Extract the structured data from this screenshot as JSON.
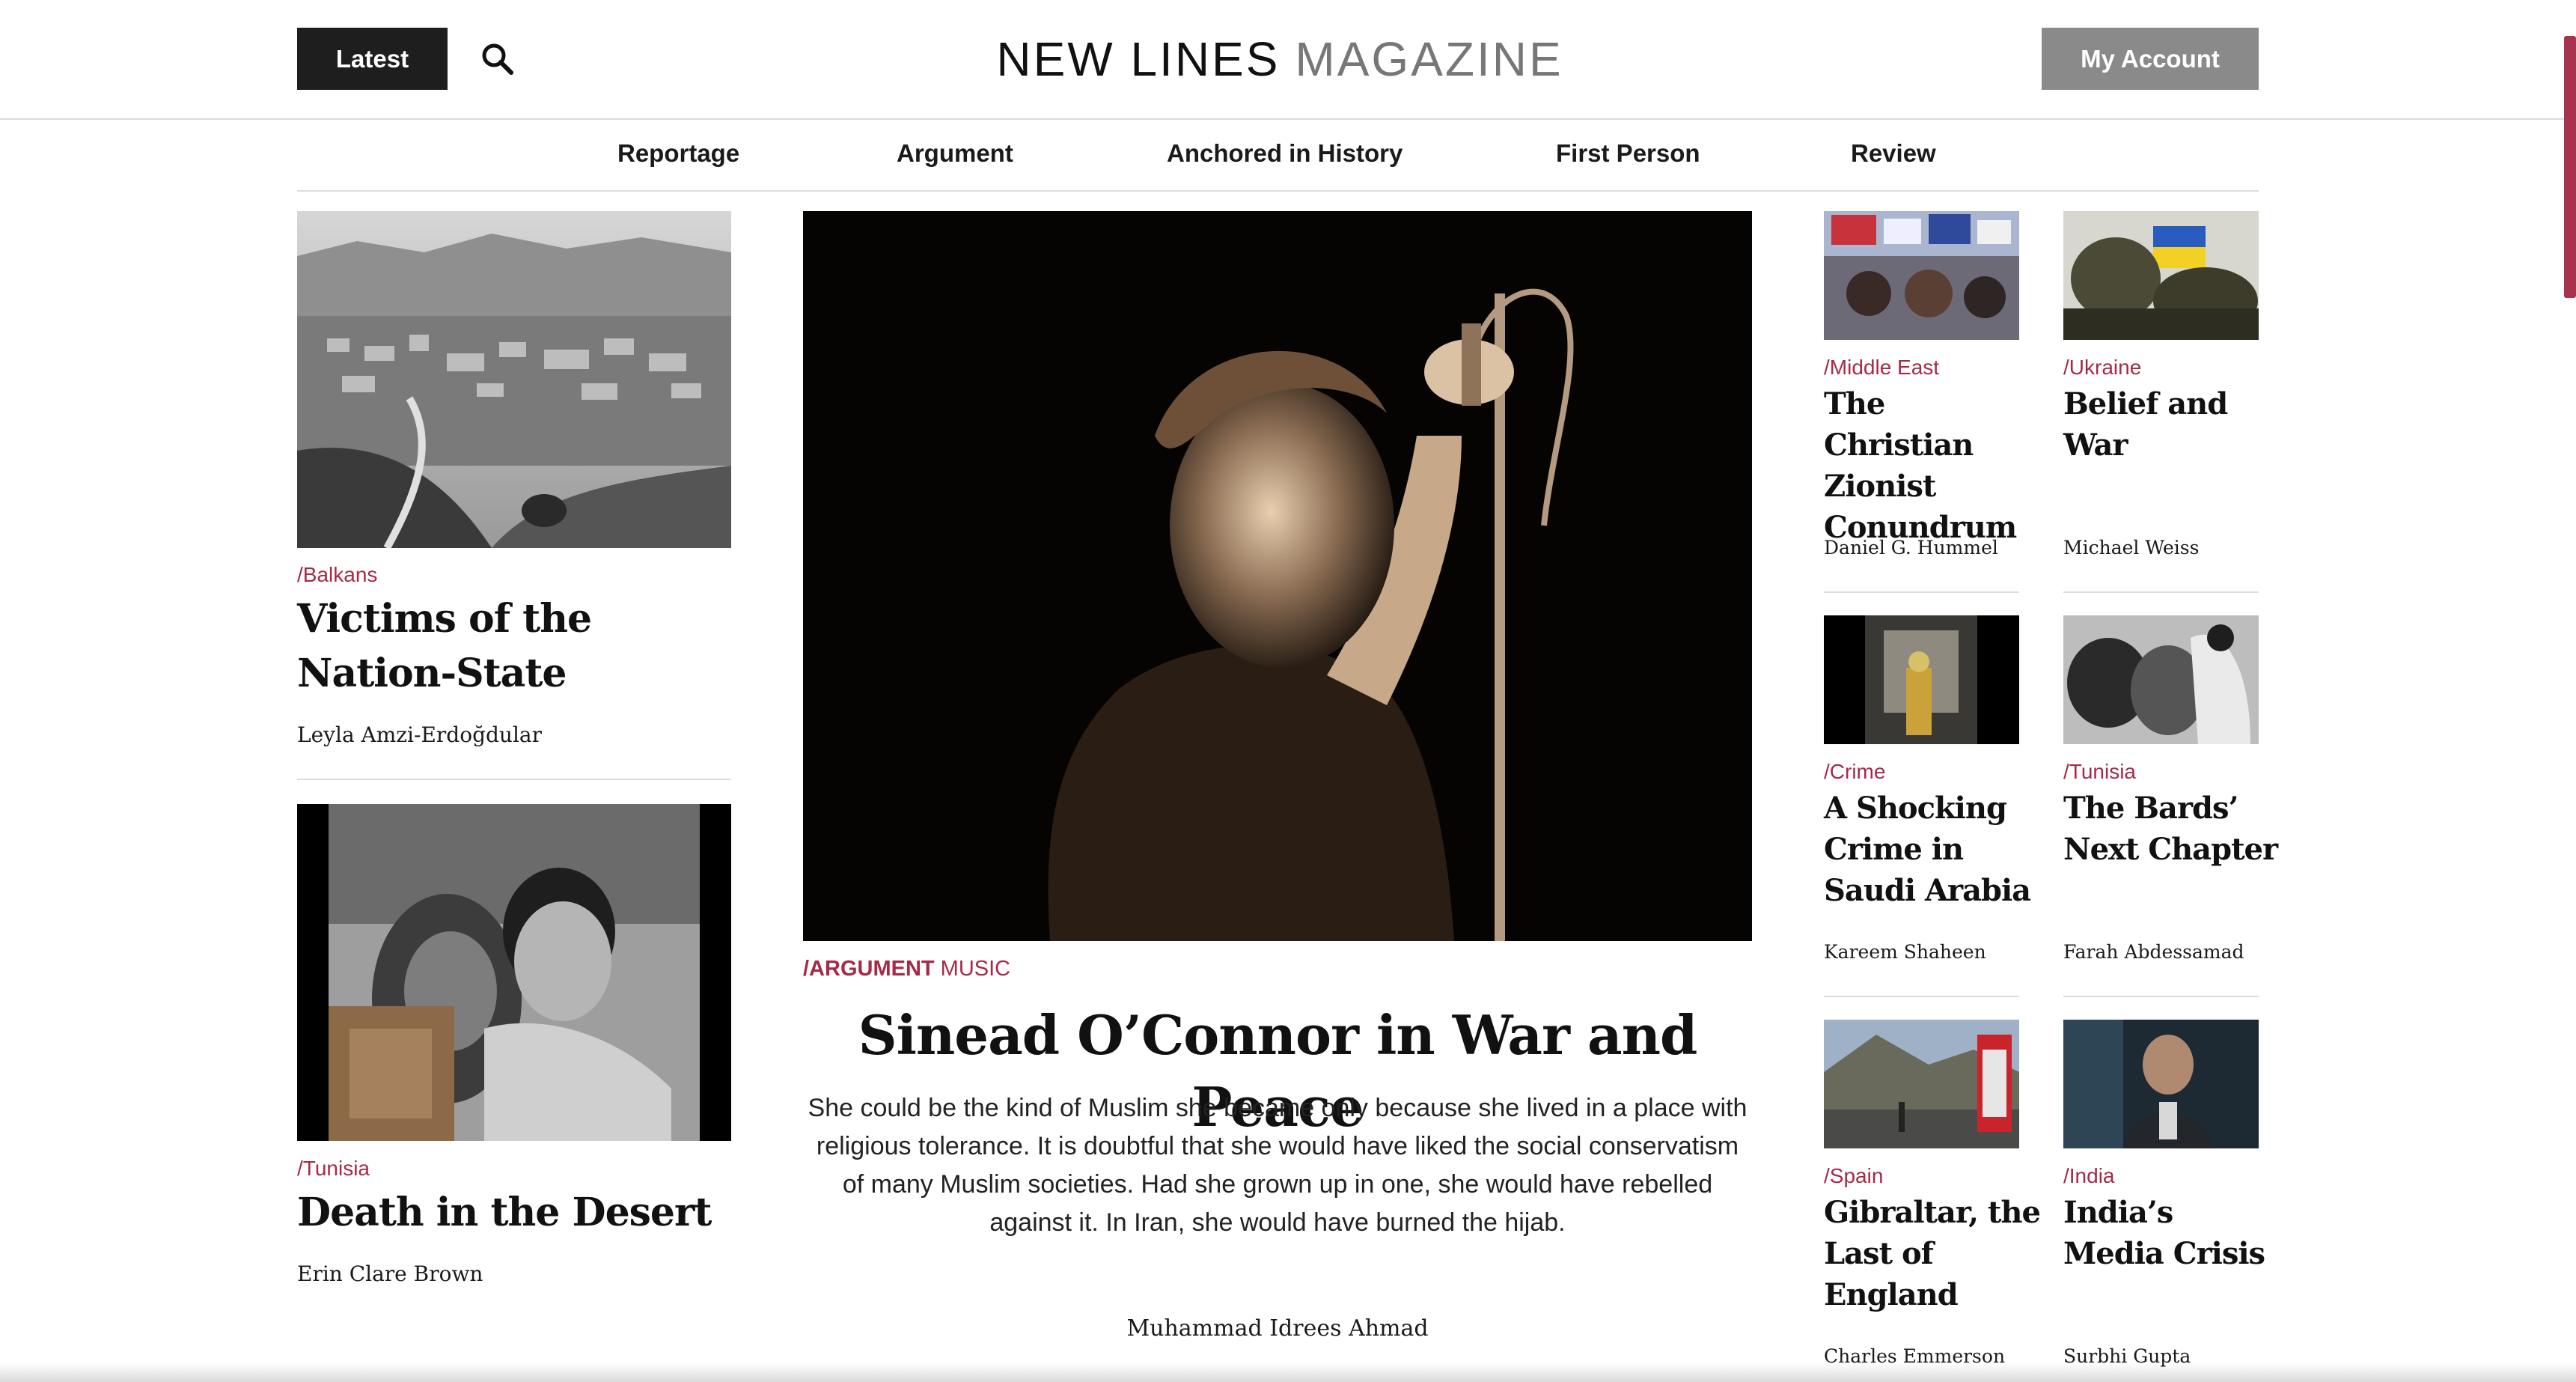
{
  "header": {
    "latest_label": "Latest",
    "logo_part1": "NEW LINES",
    "logo_part2": "MAGAZINE",
    "account_label": "My Account"
  },
  "nav": {
    "items": [
      {
        "label": "Reportage"
      },
      {
        "label": "Argument"
      },
      {
        "label": "Anchored in History"
      },
      {
        "label": "First Person"
      },
      {
        "label": "Review"
      }
    ]
  },
  "left_column": [
    {
      "tag": "/Balkans",
      "title": "Victims of the Nation-State",
      "author": "Leyla Amzi-Erdoğdular"
    },
    {
      "tag": "/Tunisia",
      "title": "Death in the Desert",
      "author": "Erin Clare Brown"
    }
  ],
  "feature": {
    "section": "/ARGUMENT",
    "subsection": "MUSIC",
    "title": "Sinead O’Connor in War and Peace",
    "dek": "She could be the kind of Muslim she became only because she lived in a place with religious tolerance. It is doubtful that she would have liked the social conservatism of many Muslim societies. Had she grown up in one, she would have rebelled against it. In Iran, she would have burned the hijab.",
    "author": "Muhammad Idrees Ahmad"
  },
  "right_grid": [
    {
      "tag": "/Middle East",
      "title": "The Christian Zionist Conundrum",
      "author": "Daniel G. Hummel"
    },
    {
      "tag": "/Ukraine",
      "title": "Belief and War",
      "author": "Michael Weiss"
    },
    {
      "tag": "/Crime",
      "title": "A Shocking Crime in Saudi Arabia",
      "author": "Kareem Shaheen"
    },
    {
      "tag": "/Tunisia",
      "title": "The Bards’ Next Chapter",
      "author": "Farah Abdessamad"
    },
    {
      "tag": "/Spain",
      "title": "Gibraltar, the Last of England",
      "author": "Charles Emmerson"
    },
    {
      "tag": "/India",
      "title": "India’s Media Crisis",
      "author": "Surbhi Gupta"
    }
  ],
  "colors": {
    "accent": "#a52a48",
    "dark_button": "#1e1e1e",
    "account_button": "#8a8a8a"
  }
}
